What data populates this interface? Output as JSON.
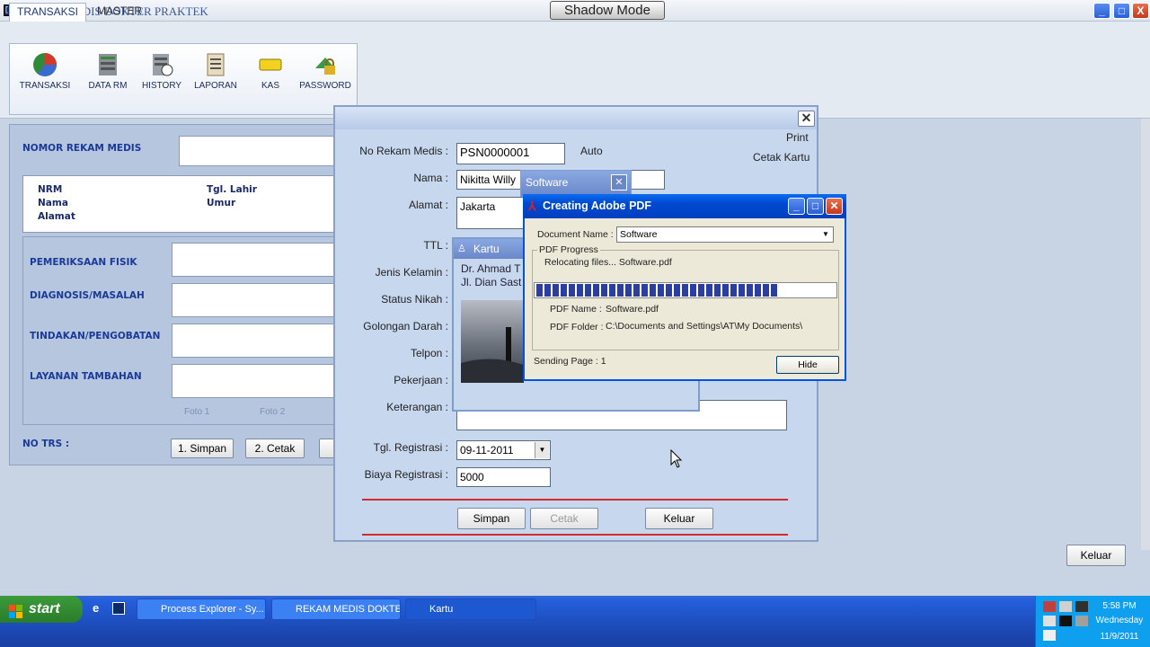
{
  "app": {
    "title": "REKAM MEDIS DOKTER PRAKTEK",
    "icon_text": "[X]",
    "shadow_mode": "Shadow Mode",
    "minimize": "_",
    "maximize": "□",
    "close": "X"
  },
  "tabs": [
    "TRANSAKSI",
    "MASTER"
  ],
  "ribbon": [
    {
      "label": "TRANSAKSI",
      "icon": "pie-chart-icon"
    },
    {
      "label": "DATA RM",
      "icon": "server-icon"
    },
    {
      "label": "HISTORY",
      "icon": "history-icon"
    },
    {
      "label": "LAPORAN",
      "icon": "report-icon"
    },
    {
      "label": "KAS",
      "icon": "cash-icon"
    },
    {
      "label": "PASSWORD",
      "icon": "lock-icon"
    }
  ],
  "left": {
    "nomor_label": "NOMOR REKAM MEDIS",
    "nrm": "NRM",
    "nama": "Nama",
    "alamat": "Alamat",
    "tgl_lahir": "Tgl. Lahir",
    "umur": "Umur",
    "pemeriksaan": "PEMERIKSAAN FISIK",
    "diagnosis": "DIAGNOSIS/MASALAH",
    "tindakan": "TINDAKAN/PENGOBATAN",
    "layanan": "LAYANAN TAMBAHAN",
    "foto1": "Foto 1",
    "foto2": "Foto 2",
    "no_trs": "NO TRS :",
    "simpan": "1. Simpan",
    "cetak": "2. Cetak"
  },
  "dialog": {
    "close": "✕",
    "print": "Print",
    "cetak_kartu": "Cetak Kartu",
    "auto": "Auto",
    "no_rm_label": "No Rekam Medis :",
    "no_rm": "PSN0000001",
    "nama_label": "Nama :",
    "nama": "Nikitta Willy",
    "alamat_label": "Alamat :",
    "alamat": "Jakarta",
    "ttl_label": "TTL :",
    "jk_label": "Jenis Kelamin :",
    "nikah_label": "Status Nikah :",
    "darah_label": "Golongan Darah :",
    "telpon_label": "Telpon :",
    "pekerjaan_label": "Pekerjaan :",
    "ket_label": "Keterangan :",
    "tgl_reg_label": "Tgl. Registrasi :",
    "tgl_reg": "09-11-2011",
    "biaya_label": "Biaya Registrasi :",
    "biaya": "5000",
    "simpan": "Simpan",
    "cetak": "Cetak",
    "keluar": "Keluar"
  },
  "kartu": {
    "title": "Kartu",
    "line1": "Dr. Ahmad T",
    "line2": "Jl. Dian Sast"
  },
  "software": {
    "title": "Software",
    "close": "✕"
  },
  "pdf": {
    "title": "Creating Adobe PDF",
    "doc_name_label": "Document Name :",
    "doc_name": "Software",
    "group": "PDF Progress",
    "status": "Relocating files...  Software.pdf",
    "progress": 0.8,
    "pdf_name_label": "PDF Name :",
    "pdf_name": "Software.pdf",
    "pdf_folder_label": "PDF Folder :",
    "pdf_folder": "C:\\Documents and Settings\\AT\\My Documents\\",
    "sending": "Sending Page : 1",
    "hide": "Hide"
  },
  "main_keluar": "Keluar",
  "taskbar": {
    "start": "start",
    "tasks": [
      "Process Explorer - Sy...",
      "REKAM MEDIS DOKTE...",
      "Kartu"
    ],
    "time": "5:58 PM",
    "day": "Wednesday",
    "date": "11/9/2011"
  }
}
